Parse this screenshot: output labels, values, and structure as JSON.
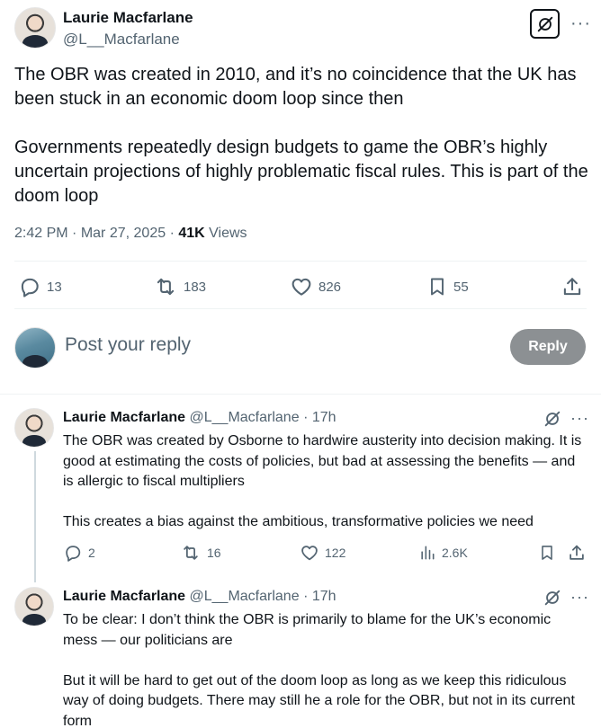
{
  "main_tweet": {
    "author_name": "Laurie Macfarlane",
    "author_handle": "@L__Macfarlane",
    "text": "The OBR was created in 2010, and it’s no coincidence that the UK has been stuck in an economic doom loop since then\n\nGovernments repeatedly design budgets to game the OBR’s highly uncertain projections of highly problematic fiscal rules. This is part of the doom loop",
    "time": "2:42 PM",
    "date": "Mar 27, 2025",
    "views_count": "41K",
    "views_label": "Views",
    "replies": "13",
    "reposts": "183",
    "likes": "826",
    "bookmarks": "55",
    "more_label": "···"
  },
  "composer": {
    "placeholder": "Post your reply",
    "reply_button": "Reply"
  },
  "replies": [
    {
      "author_name": "Laurie Macfarlane",
      "author_handle": "@L__Macfarlane",
      "separator": "·",
      "age": "17h",
      "text": "The OBR was created by Osborne to hardwire austerity into decision making. It is good at estimating the costs of policies, but bad at assessing the benefits — and is allergic to fiscal multipliers\n\nThis creates a bias against the ambitious, transformative policies we need",
      "replies": "2",
      "reposts": "16",
      "likes": "122",
      "views": "2.6K",
      "more_label": "···"
    },
    {
      "author_name": "Laurie Macfarlane",
      "author_handle": "@L__Macfarlane",
      "separator": "·",
      "age": "17h",
      "text": "To be clear: I don’t think the OBR is primarily to blame for the UK’s economic mess — our politicians are\n\nBut it will be hard to get out of the doom loop as long as we keep this ridiculous way of doing budgets. There may still he a role for the OBR, but not in its current form",
      "more_label": "···"
    }
  ],
  "icons": {
    "grok": "grok-icon",
    "reply": "reply-icon",
    "repost": "repost-icon",
    "like": "heart-icon",
    "bookmark": "bookmark-icon",
    "share": "share-icon",
    "views": "analytics-icon"
  },
  "colors": {
    "text_primary": "#0f1419",
    "text_secondary": "#536471",
    "divider": "#eff3f4",
    "reply_button_bg": "#8c9093",
    "thread_line": "#cfd9de"
  }
}
